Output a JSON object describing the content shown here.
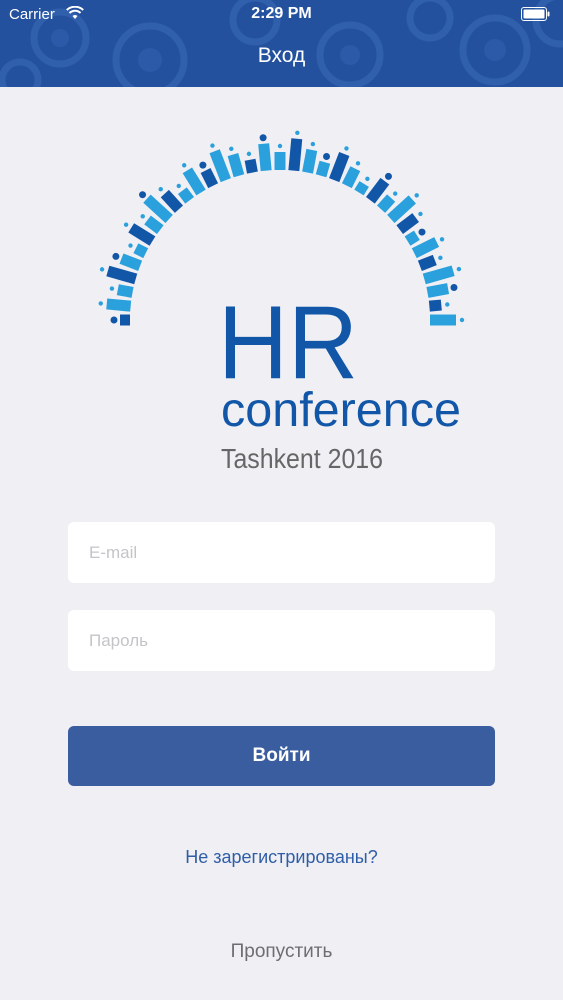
{
  "status_bar": {
    "carrier": "Carrier",
    "time": "2:29 PM"
  },
  "nav": {
    "title": "Вход"
  },
  "logo": {
    "line1": "HR",
    "line2": "conference",
    "line3": "Tashkent 2016"
  },
  "form": {
    "email_placeholder": "E-mail",
    "password_placeholder": "Пароль",
    "login_label": "Войти"
  },
  "links": {
    "register": "Не зарегистрированы?",
    "skip": "Пропустить"
  },
  "colors": {
    "nav_background": "#24519e",
    "button": "#3a5da0",
    "link": "#2f5ea8",
    "logo_dark": "#1256a8",
    "logo_light": "#2aa0dc"
  }
}
